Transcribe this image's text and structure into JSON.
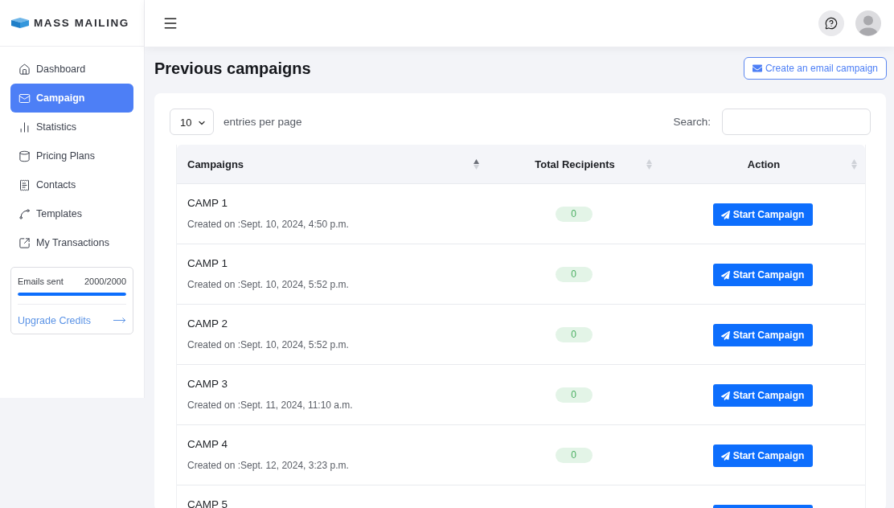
{
  "sidebar": {
    "logo": "MASS MAILING",
    "items": [
      {
        "label": "Dashboard",
        "selected": false
      },
      {
        "label": "Campaign",
        "selected": true
      },
      {
        "label": "Statistics",
        "selected": false
      },
      {
        "label": "Pricing Plans",
        "selected": false
      },
      {
        "label": "Contacts",
        "selected": false
      },
      {
        "label": "Templates",
        "selected": false
      },
      {
        "label": "My Transactions",
        "selected": false
      }
    ],
    "credits": {
      "label": "Emails sent",
      "count": "2000/2000",
      "level": 1,
      "link": "Upgrade Credits"
    }
  },
  "page": {
    "title": "Previous campaigns",
    "create_button": "Create an email campaign"
  },
  "table_controls": {
    "page_size": "10",
    "page_size_label": "entries per page",
    "search_label": "Search:"
  },
  "table": {
    "columns": [
      {
        "label": "Campaigns",
        "sorted": true
      },
      {
        "label": "Total Recipients",
        "sorted": false
      },
      {
        "label": "Action",
        "sorted": false
      }
    ],
    "rows": [
      {
        "name": "CAMP 1",
        "created": "Created on :Sept. 10, 2024, 4:50 p.m.",
        "recipients": "0",
        "action": "Start Campaign"
      },
      {
        "name": "CAMP 1",
        "created": "Created on :Sept. 10, 2024, 5:52 p.m.",
        "recipients": "0",
        "action": "Start Campaign"
      },
      {
        "name": "CAMP 2",
        "created": "Created on :Sept. 10, 2024, 5:52 p.m.",
        "recipients": "0",
        "action": "Start Campaign"
      },
      {
        "name": "CAMP 3",
        "created": "Created on :Sept. 11, 2024, 11:10 a.m.",
        "recipients": "0",
        "action": "Start Campaign"
      },
      {
        "name": "CAMP 4",
        "created": "Created on :Sept. 12, 2024, 3:23 p.m.",
        "recipients": "0",
        "action": "Start Campaign"
      },
      {
        "name": "CAMP 5"
      }
    ]
  }
}
